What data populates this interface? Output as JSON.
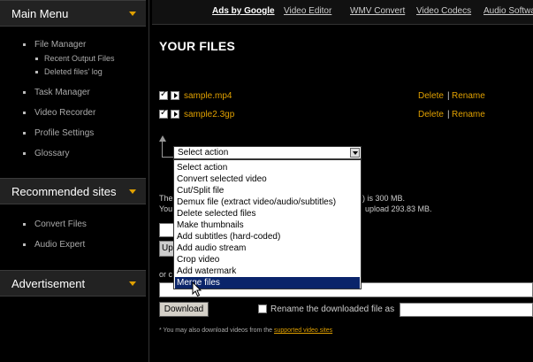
{
  "sidebar": {
    "main_menu": "Main Menu",
    "items": {
      "file_manager": "File Manager",
      "recent_output": "Recent Output Files",
      "deleted_log": "Deleted files' log",
      "task_manager": "Task Manager",
      "video_recorder": "Video Recorder",
      "profile_settings": "Profile Settings",
      "glossary": "Glossary"
    },
    "recommended": "Recommended sites",
    "rec_items": {
      "convert_files": "Convert Files",
      "audio_expert": "Audio Expert"
    },
    "advertisement": "Advertisement"
  },
  "topbar": {
    "ads": "Ads by Google",
    "video_editor": "Video Editor",
    "wmv_convert": "WMV Convert",
    "video_codecs": "Video Codecs",
    "audio_software": "Audio Software"
  },
  "main": {
    "title": "YOUR FILES",
    "files": [
      {
        "name": "sample.mp4",
        "delete": "Delete",
        "sep": "|",
        "rename": "Rename"
      },
      {
        "name": "sample2.3gp",
        "delete": "Delete",
        "sep": "|",
        "rename": "Rename"
      }
    ],
    "select_value": "Select action",
    "options": [
      "Select action",
      "Convert selected video",
      "Cut/Split file",
      "Demux file (extract video/audio/subtitles)",
      "Delete selected files",
      "Make thumbnails",
      "Add subtitles (hard-coded)",
      "Add audio stream",
      "Crop video",
      "Add watermark",
      "Merge files"
    ],
    "highlighted_option": "Merge files",
    "bg_text_1_prefix": "The",
    "bg_text_1_suffix": ") is 300 MB.",
    "bg_text_2_prefix": "You",
    "bg_text_2_suffix": "upload 293.83 MB.",
    "upload_btn": "Up",
    "or_text": "or c",
    "download_btn": "Download",
    "rename_label": "Rename the downloaded file as",
    "note_prefix": "You may also download videos from the",
    "note_link": "supported video sites"
  },
  "colors": {
    "accent": "#e0a000",
    "highlight": "#0a246a"
  }
}
